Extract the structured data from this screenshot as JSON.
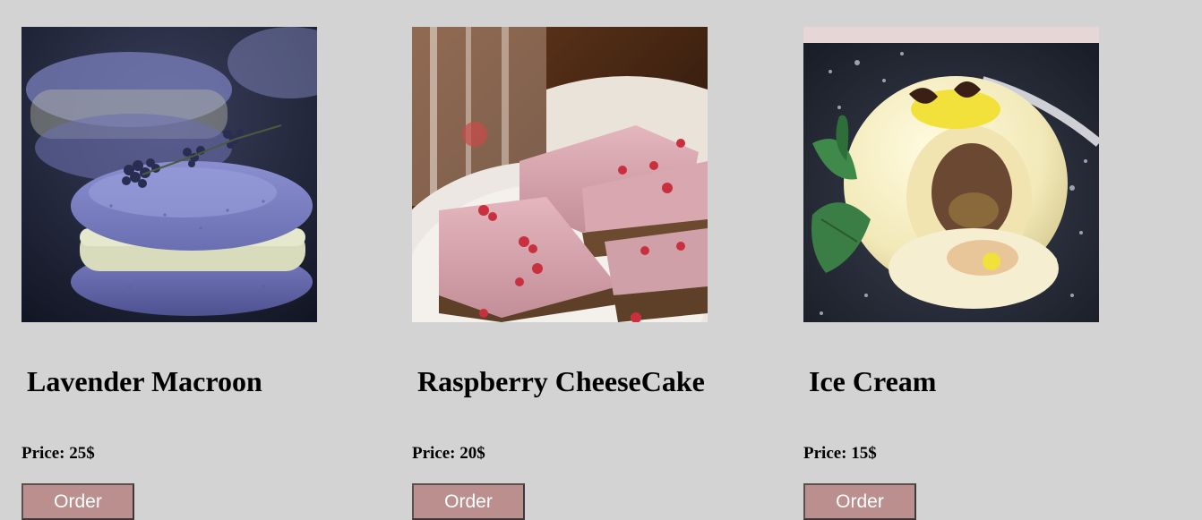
{
  "products": [
    {
      "name": "Lavender Macroon",
      "price_label": "Price: 25$",
      "order_label": "Order",
      "image_icon": "lavender-macaron-photo"
    },
    {
      "name": "Raspberry CheeseCake",
      "price_label": "Price: 20$",
      "order_label": "Order",
      "image_icon": "raspberry-cheesecake-photo"
    },
    {
      "name": "Ice Cream",
      "price_label": "Price: 15$",
      "order_label": "Order",
      "image_icon": "ice-cream-dessert-photo"
    }
  ],
  "colors": {
    "page_background": "#d3d3d3",
    "button_background": "#bc8f8f",
    "button_text": "#ffffff",
    "heading_text": "#000000"
  }
}
